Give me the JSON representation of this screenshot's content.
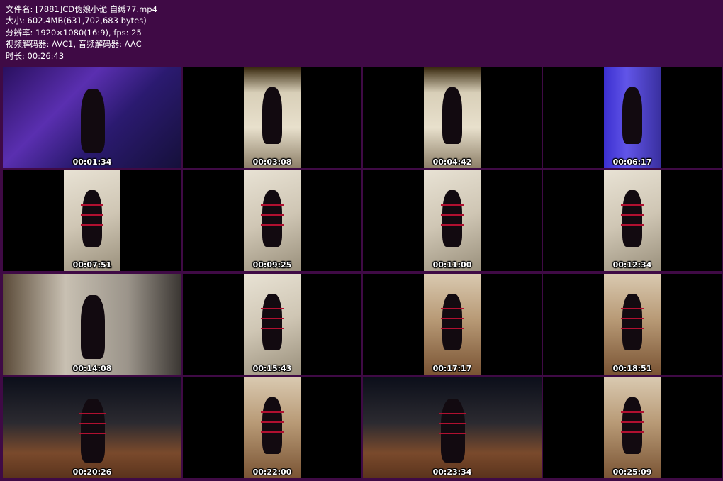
{
  "info": {
    "filename": "文件名: [7881]CD伪娘小诡 自缚77.mp4",
    "size": "大小: 602.4MB(631,702,683 bytes)",
    "resolution": "分辨率: 1920×1080(16:9), fps: 25",
    "codecs": "视频解码器: AVC1, 音频解码器: AAC",
    "duration": "时长: 00:26:43"
  },
  "colors": {
    "background": "#3f0a45",
    "text": "#ffffff",
    "cell": "#000000"
  },
  "thumbnails": [
    {
      "time": "00:01:34",
      "scene": "room",
      "frame": "full"
    },
    {
      "time": "00:03:08",
      "scene": "hall",
      "frame": "portrait"
    },
    {
      "time": "00:04:42",
      "scene": "hall",
      "frame": "portrait"
    },
    {
      "time": "00:06:17",
      "scene": "door",
      "frame": "portrait"
    },
    {
      "time": "00:07:51",
      "scene": "chair",
      "frame": "portrait"
    },
    {
      "time": "00:09:25",
      "scene": "chair",
      "frame": "portrait"
    },
    {
      "time": "00:11:00",
      "scene": "chair",
      "frame": "portrait"
    },
    {
      "time": "00:12:34",
      "scene": "chair",
      "frame": "portrait"
    },
    {
      "time": "00:14:08",
      "scene": "living",
      "frame": "full"
    },
    {
      "time": "00:15:43",
      "scene": "chair",
      "frame": "portrait"
    },
    {
      "time": "00:17:17",
      "scene": "bath",
      "frame": "portrait"
    },
    {
      "time": "00:18:51",
      "scene": "bath",
      "frame": "portrait"
    },
    {
      "time": "00:20:26",
      "scene": "balcony",
      "frame": "full"
    },
    {
      "time": "00:22:00",
      "scene": "bath",
      "frame": "portrait"
    },
    {
      "time": "00:23:34",
      "scene": "balcony",
      "frame": "full"
    },
    {
      "time": "00:25:09",
      "scene": "bath",
      "frame": "portrait"
    }
  ]
}
